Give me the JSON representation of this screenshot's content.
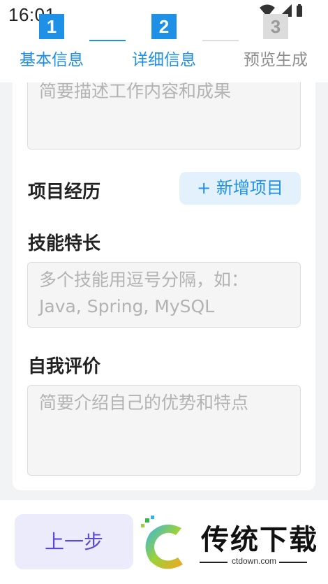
{
  "status_bar": {
    "time": "16:01"
  },
  "stepper": {
    "steps": [
      {
        "number": "1",
        "label": "基本信息",
        "state": "done"
      },
      {
        "number": "2",
        "label": "详细信息",
        "state": "active"
      },
      {
        "number": "3",
        "label": "预览生成",
        "state": "pending"
      }
    ]
  },
  "form": {
    "work_description_placeholder": "简要描述工作内容和成果",
    "project_section_title": "项目经历",
    "add_project_button": "+ 新增项目",
    "skills_title": "技能特长",
    "skills_placeholder": "多个技能用逗号分隔，如：Java, Spring, MySQL",
    "self_eval_title": "自我评价",
    "self_eval_placeholder": "简要介绍自己的优势和特点"
  },
  "footer": {
    "prev_button": "上一步",
    "watermark_title": "传统下载",
    "watermark_url": "ctdown.com"
  },
  "colors": {
    "accent": "#1e90e6",
    "prev_button_text": "#5a48d6",
    "prev_button_bg": "#ecebfc"
  }
}
